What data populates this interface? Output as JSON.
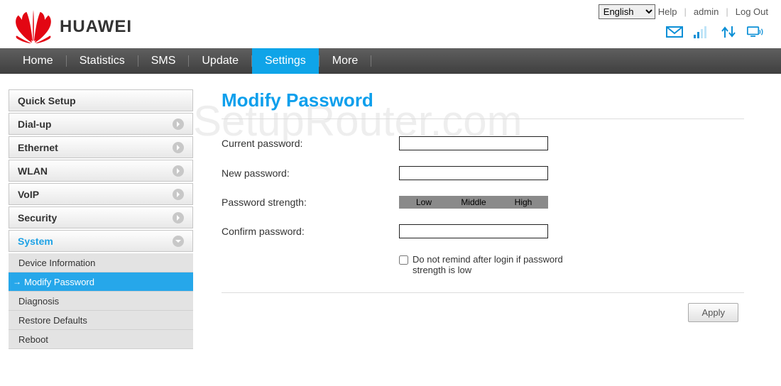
{
  "header": {
    "brand": "HUAWEI",
    "language_options": [
      "English"
    ],
    "language_selected": "English",
    "help": "Help",
    "user": "admin",
    "logout": "Log Out"
  },
  "nav": {
    "items": [
      "Home",
      "Statistics",
      "SMS",
      "Update",
      "Settings",
      "More"
    ],
    "active": "Settings"
  },
  "sidebar": {
    "groups": [
      {
        "label": "Quick Setup",
        "expandable": false
      },
      {
        "label": "Dial-up",
        "expandable": true
      },
      {
        "label": "Ethernet",
        "expandable": true
      },
      {
        "label": "WLAN",
        "expandable": true
      },
      {
        "label": "VoIP",
        "expandable": true
      },
      {
        "label": "Security",
        "expandable": true
      },
      {
        "label": "System",
        "expandable": true,
        "active": true,
        "subitems": [
          "Device Information",
          "Modify Password",
          "Diagnosis",
          "Restore Defaults",
          "Reboot"
        ],
        "active_sub": "Modify Password"
      }
    ]
  },
  "page": {
    "title": "Modify Password",
    "fields": {
      "current": "Current password:",
      "new": "New password:",
      "strength": "Password strength:",
      "confirm": "Confirm password:"
    },
    "strength_levels": [
      "Low",
      "Middle",
      "High"
    ],
    "checkbox": "Do not remind after login if password strength is low",
    "apply": "Apply"
  },
  "watermark": "SetupRouter.com"
}
